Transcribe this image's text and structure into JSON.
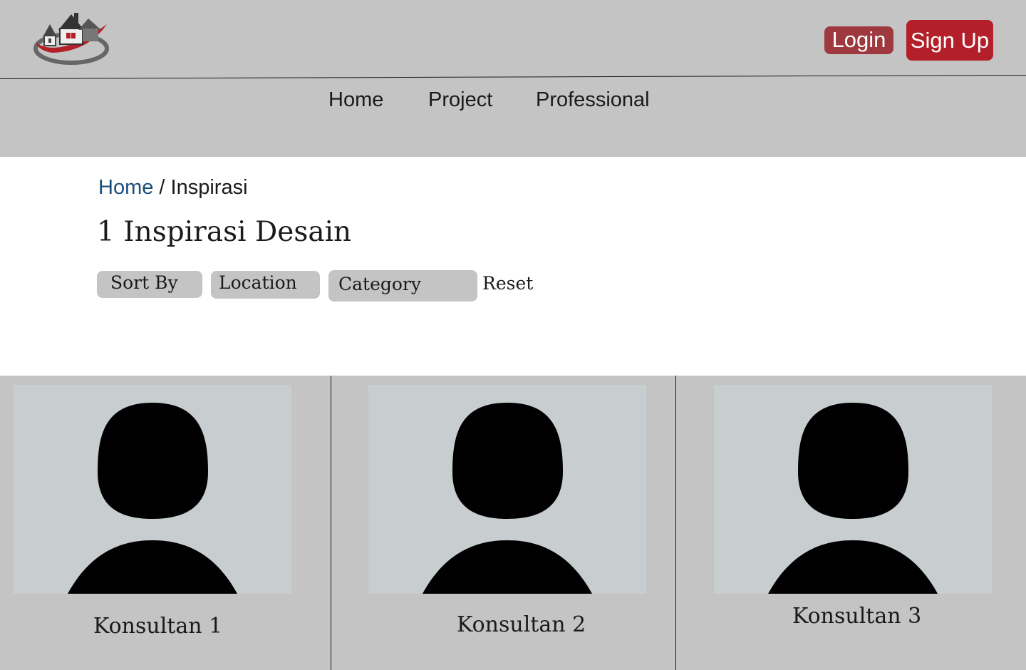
{
  "header": {
    "login_label": "Login",
    "signup_label": "Sign Up",
    "accent_color": "#b3202a"
  },
  "nav": {
    "items": [
      {
        "label": "Home"
      },
      {
        "label": "Project"
      },
      {
        "label": "Professional"
      }
    ]
  },
  "breadcrumb": {
    "home": "Home",
    "separator": " / ",
    "current": "Inspirasi"
  },
  "page": {
    "title": "1 Inspirasi Desain"
  },
  "filters": {
    "sort_by": "Sort By",
    "location": "Location",
    "category": "Category",
    "reset": "Reset"
  },
  "cards": [
    {
      "name": "Konsultan 1",
      "image_icon": "avatar-placeholder-icon"
    },
    {
      "name": "Konsultan 2",
      "image_icon": "avatar-placeholder-icon"
    },
    {
      "name": "Konsultan 3",
      "image_icon": "avatar-placeholder-icon"
    }
  ]
}
